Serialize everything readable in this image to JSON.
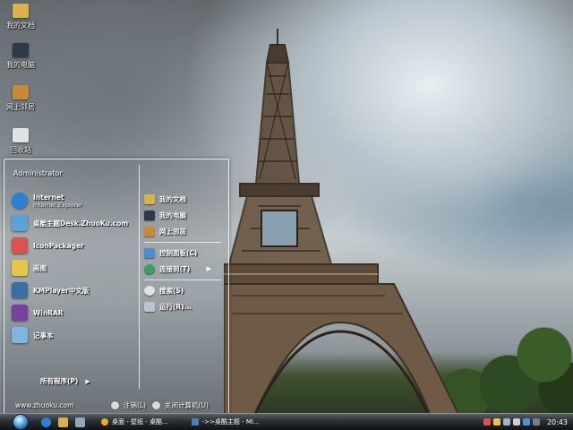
{
  "desktop_icons": [
    {
      "name": "documents",
      "label": "我的文档",
      "icon": "folder-icon",
      "color": "#d9b24c"
    },
    {
      "name": "computer",
      "label": "我的电脑",
      "icon": "computer-icon",
      "color": "#2d3a47"
    },
    {
      "name": "network",
      "label": "网上邻居",
      "icon": "network-icon",
      "color": "#c68a3a"
    },
    {
      "name": "recycle",
      "label": "回收站",
      "icon": "recycle-bin-icon",
      "color": "#dfe3e6"
    }
  ],
  "start_menu": {
    "user_name": "Administrator",
    "pinned": [
      {
        "title": "Internet",
        "subtitle": "Internet Explorer",
        "icon": "internet-explorer-icon",
        "color": "#2f7fd6"
      },
      {
        "title": "桌酷主题Desk.ZhuoKu.com",
        "subtitle": "",
        "icon": "theme-icon",
        "color": "#5aa3d8"
      },
      {
        "title": "IconPackager",
        "subtitle": "",
        "icon": "iconpackager-icon",
        "color": "#d9534f"
      },
      {
        "title": "画图",
        "subtitle": "",
        "icon": "paint-icon",
        "color": "#e8c547"
      },
      {
        "title": "KMPlayer中文版",
        "subtitle": "",
        "icon": "kmplayer-icon",
        "color": "#3a6ea5"
      },
      {
        "title": "WinRAR",
        "subtitle": "",
        "icon": "winrar-icon",
        "color": "#7b3f9e"
      },
      {
        "title": "记事本",
        "subtitle": "",
        "icon": "notepad-icon",
        "color": "#7fb6e0"
      }
    ],
    "places": [
      {
        "label": "我的文档",
        "icon": "folder-icon",
        "color": "#d9b24c"
      },
      {
        "label": "我的电脑",
        "icon": "computer-icon",
        "color": "#2d3a47"
      },
      {
        "label": "网上邻居",
        "icon": "network-icon",
        "color": "#c68a3a"
      }
    ],
    "system": [
      {
        "label": "控制面板(C)",
        "icon": "control-panel-icon",
        "color": "#4a8fd1",
        "arrow": ""
      },
      {
        "label": "连接到(T)",
        "icon": "connect-icon",
        "color": "#3aa060",
        "arrow": "▶"
      },
      {
        "label": "搜索(S)",
        "icon": "search-icon",
        "color": "#e2e2e2",
        "arrow": ""
      },
      {
        "label": "运行(R)...",
        "icon": "run-icon",
        "color": "#b8c4d0",
        "arrow": ""
      }
    ],
    "all_programs": "所有程序(P)",
    "all_programs_arrow": "▶",
    "site": "www.zhuoku.com",
    "logoff": "注销(L)",
    "shutdown": "关闭计算机(U)"
  },
  "taskbar": {
    "tasks": [
      {
        "label": "桌面 - 壁纸 - 桌酷...",
        "icon": "chrome-icon",
        "color": "#e0b030"
      },
      {
        "label": "->>桌酷主题 - Mi...",
        "icon": "window-icon",
        "color": "#4a7fc0"
      }
    ],
    "clock": "20:43"
  }
}
